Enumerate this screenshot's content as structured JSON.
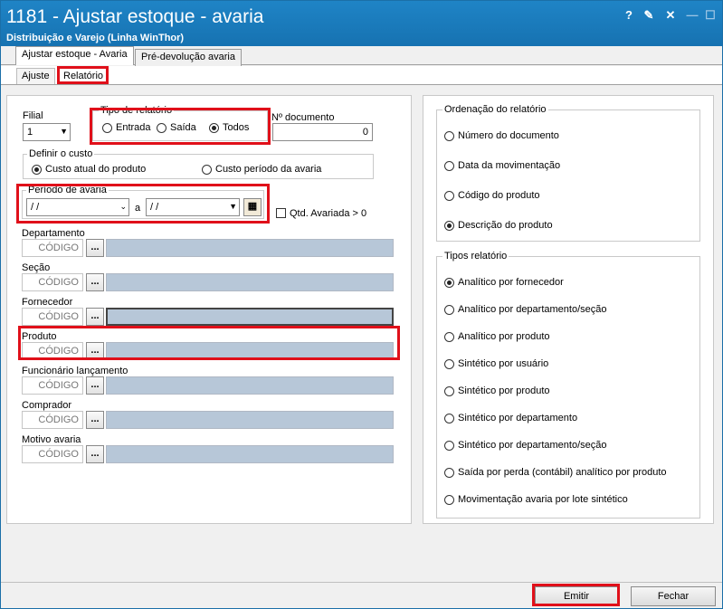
{
  "window": {
    "title": "1181 - Ajustar estoque - avaria",
    "subtitle": "Distribuição e Varejo (Linha WinThor)",
    "help_label": "?",
    "edit_glyph": "✎",
    "close_glyph": "✕",
    "minimize_glyph": "—",
    "maximize_glyph": "☐"
  },
  "tabs": [
    {
      "label": "Ajustar estoque - Avaria"
    },
    {
      "label": "Pré-devolução avaria"
    }
  ],
  "subtabs": [
    {
      "label": "Ajuste"
    },
    {
      "label": "Relatório"
    }
  ],
  "form": {
    "filial_label": "Filial",
    "filial_value": "1",
    "tipo_relatorio_label": "Tipo de relatório",
    "tipo_options": [
      {
        "label": "Entrada",
        "selected": false
      },
      {
        "label": "Saída",
        "selected": false
      },
      {
        "label": "Todos",
        "selected": true
      }
    ],
    "num_doc_label": "Nº documento",
    "num_doc_value": "0",
    "custo_label": "Definir o custo",
    "custo_options": [
      {
        "label": "Custo atual do produto",
        "selected": true
      },
      {
        "label": "Custo período da avaria",
        "selected": false
      }
    ],
    "periodo_label": "Período de avaria",
    "periodo_from": "/ /",
    "periodo_sep": "a",
    "periodo_to": "/ /",
    "qtd_label": "Qtd. Avariada > 0",
    "filters": [
      {
        "label": "Departamento",
        "placeholder": "CÓDIGO"
      },
      {
        "label": "Seção",
        "placeholder": "CÓDIGO"
      },
      {
        "label": "Fornecedor",
        "placeholder": "CÓDIGO"
      },
      {
        "label": "Produto",
        "placeholder": "CÓDIGO"
      },
      {
        "label": "Funcionário lançamento",
        "placeholder": "CÓDIGO"
      },
      {
        "label": "Comprador",
        "placeholder": "CÓDIGO"
      },
      {
        "label": "Motivo avaria",
        "placeholder": "CÓDIGO"
      }
    ],
    "dots_label": "..."
  },
  "ordenacao": {
    "title": "Ordenação do relatório",
    "options": [
      {
        "label": "Número do documento",
        "selected": false
      },
      {
        "label": "Data da movimentação",
        "selected": false
      },
      {
        "label": "Código do produto",
        "selected": false
      },
      {
        "label": "Descrição do produto",
        "selected": true
      }
    ]
  },
  "tipos": {
    "title": "Tipos relatório",
    "options": [
      {
        "label": "Analítico por fornecedor",
        "selected": true
      },
      {
        "label": "Analítico por departamento/seção",
        "selected": false
      },
      {
        "label": "Analítico por produto",
        "selected": false
      },
      {
        "label": "Sintético por usuário",
        "selected": false
      },
      {
        "label": "Sintético por produto",
        "selected": false
      },
      {
        "label": "Sintético por departamento",
        "selected": false
      },
      {
        "label": "Sintético por departamento/seção",
        "selected": false
      },
      {
        "label": "Saída por perda (contábil) analítico por produto",
        "selected": false
      },
      {
        "label": "Movimentação avaria por lote sintético",
        "selected": false
      }
    ]
  },
  "buttons": {
    "emitir": "Emitir",
    "fechar": "Fechar"
  },
  "colors": {
    "titlebar": "#1a7bbd",
    "highlight": "#e0101a",
    "desc_field": "#b7c7d8"
  }
}
